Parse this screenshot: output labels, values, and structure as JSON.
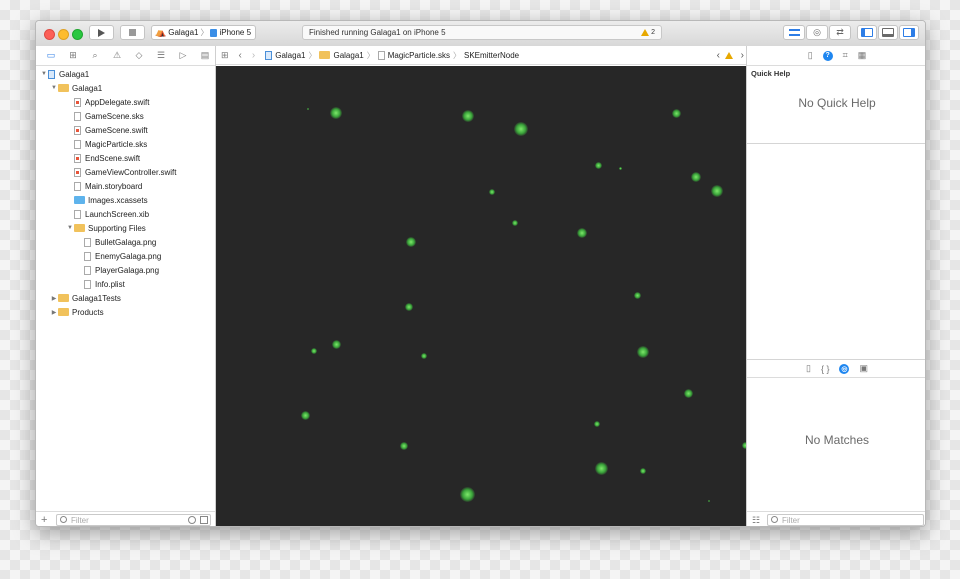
{
  "toolbar": {
    "scheme_target": "Galaga1",
    "scheme_device": "iPhone 5",
    "status_text": "Finished running Galaga1 on iPhone 5",
    "warning_count": "2",
    "run_icon": "play-icon",
    "stop_icon": "stop-icon"
  },
  "navigator": {
    "tabs": [
      "folder-icon",
      "symbol-icon",
      "search-icon",
      "warning-icon",
      "test-icon",
      "debug-icon",
      "breakpoint-icon",
      "report-icon"
    ],
    "tree": [
      {
        "label": "Galaga1",
        "kind": "project",
        "depth": 0,
        "expanded": true
      },
      {
        "label": "Galaga1",
        "kind": "folder",
        "depth": 1,
        "expanded": true
      },
      {
        "label": "AppDelegate.swift",
        "kind": "swift",
        "depth": 2
      },
      {
        "label": "GameScene.sks",
        "kind": "file",
        "depth": 2
      },
      {
        "label": "GameScene.swift",
        "kind": "swift",
        "depth": 2
      },
      {
        "label": "MagicParticle.sks",
        "kind": "file",
        "depth": 2
      },
      {
        "label": "EndScene.swift",
        "kind": "swift",
        "depth": 2
      },
      {
        "label": "GameViewController.swift",
        "kind": "swift",
        "depth": 2
      },
      {
        "label": "Main.storyboard",
        "kind": "file",
        "depth": 2
      },
      {
        "label": "Images.xcassets",
        "kind": "bluefolder",
        "depth": 2
      },
      {
        "label": "LaunchScreen.xib",
        "kind": "file",
        "depth": 2
      },
      {
        "label": "Supporting Files",
        "kind": "folder",
        "depth": 2,
        "expanded": true
      },
      {
        "label": "BulletGalaga.png",
        "kind": "file",
        "depth": 3
      },
      {
        "label": "EnemyGalaga.png",
        "kind": "file",
        "depth": 3
      },
      {
        "label": "PlayerGalaga.png",
        "kind": "file",
        "depth": 3
      },
      {
        "label": "Info.plist",
        "kind": "file",
        "depth": 3
      },
      {
        "label": "Galaga1Tests",
        "kind": "folder",
        "depth": 1,
        "expanded": false
      },
      {
        "label": "Products",
        "kind": "folder",
        "depth": 1,
        "expanded": false
      }
    ],
    "filter_placeholder": "Filter"
  },
  "jumpbar": {
    "crumbs": [
      "Galaga1",
      "Galaga1",
      "MagicParticle.sks",
      "SKEmitterNode"
    ]
  },
  "canvas": {
    "background": "#272727",
    "particle_color": "#5fd24f"
  },
  "inspector": {
    "section_title": "Quick Help",
    "empty_text": "No Quick Help",
    "library_empty_text": "No Matches",
    "filter_placeholder": "Filter"
  }
}
